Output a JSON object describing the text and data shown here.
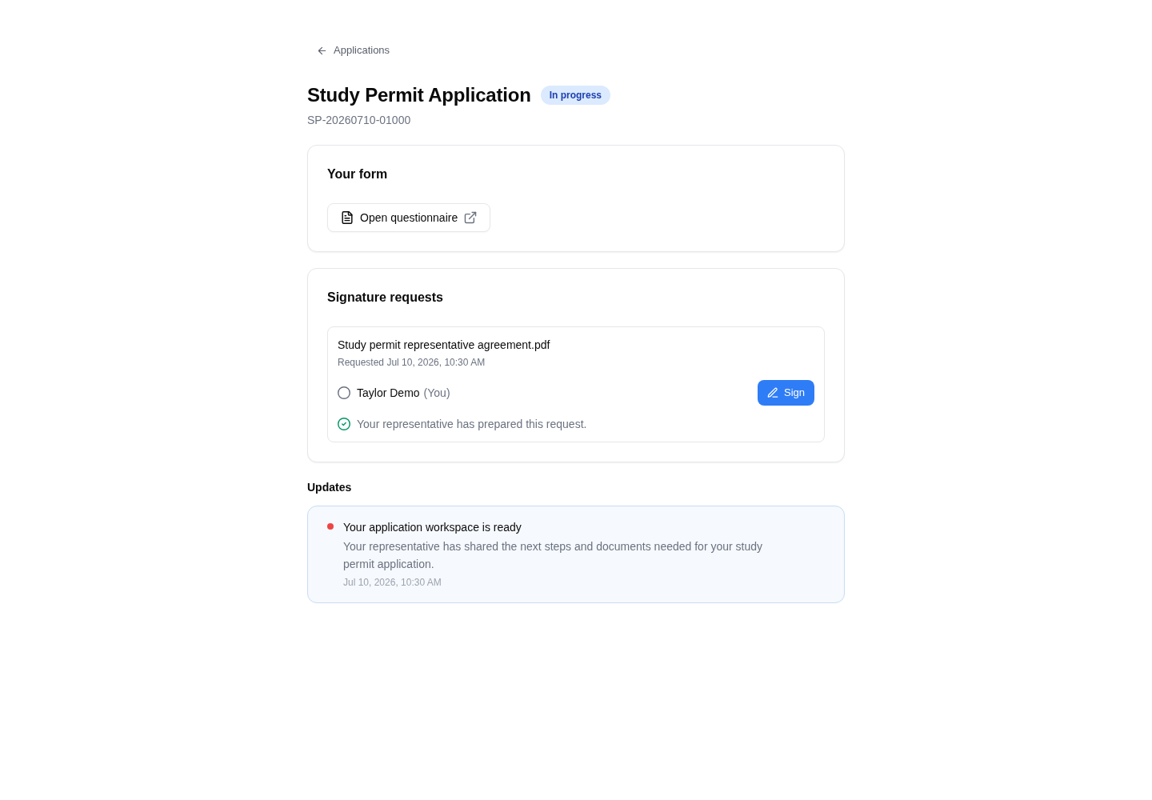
{
  "back_link": {
    "label": "Applications"
  },
  "header": {
    "title": "Study Permit Application",
    "status": {
      "label": "In progress",
      "kind": "in_progress"
    },
    "reference": "SP-20260710-01000"
  },
  "form_card": {
    "title": "Your form",
    "button": {
      "label": "Open questionnaire"
    }
  },
  "signature_card": {
    "title": "Signature requests",
    "requests": [
      {
        "document": "Study permit representative agreement.pdf",
        "requested": "Requested Jul 10, 2026, 10:30 AM",
        "signers": [
          {
            "name": "Taylor Demo",
            "note": "(You)",
            "signed": false,
            "action": "Sign"
          }
        ],
        "prepared": {
          "text": "Your representative has prepared this request.",
          "done": true
        }
      }
    ]
  },
  "updates": {
    "title": "Updates",
    "items": [
      {
        "title": "Your application workspace is ready",
        "body": "Your representative has shared the next steps and documents needed for your study permit application.",
        "time": "Jul 10, 2026, 10:30 AM",
        "unread": true
      }
    ]
  }
}
